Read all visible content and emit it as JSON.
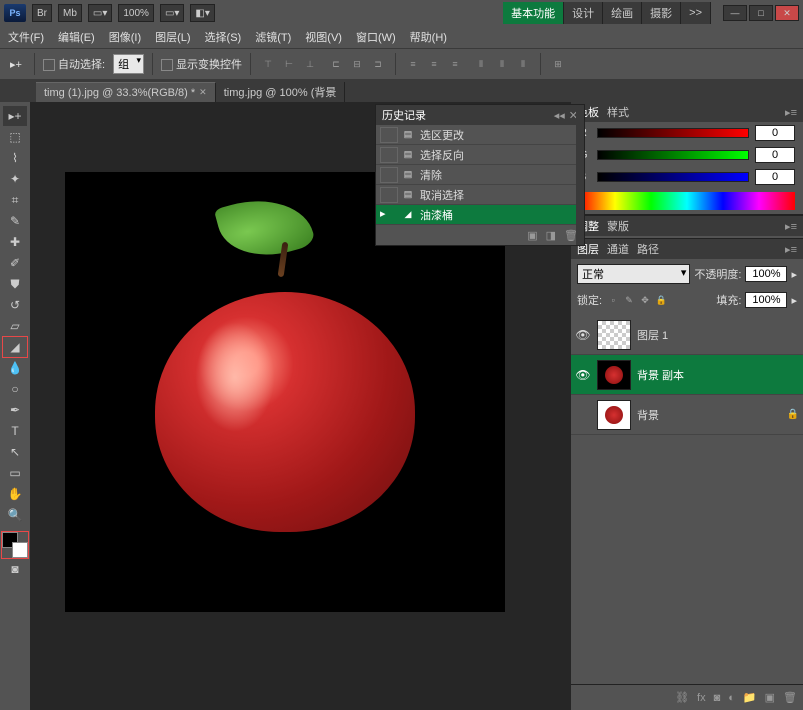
{
  "top": {
    "zoom": "100%",
    "workspaces": [
      "基本功能",
      "设计",
      "绘画",
      "摄影"
    ],
    "ws_more": ">>",
    "win": {
      "min": "—",
      "max": "□",
      "close": "✕"
    }
  },
  "menu": [
    "文件(F)",
    "编辑(E)",
    "图像(I)",
    "图层(L)",
    "选择(S)",
    "滤镜(T)",
    "视图(V)",
    "窗口(W)",
    "帮助(H)"
  ],
  "options": {
    "auto_select": "自动选择:",
    "group": "组",
    "show_transform": "显示变换控件"
  },
  "tabs": [
    {
      "label": "timg (1).jpg @ 33.3%(RGB/8) *",
      "active": true
    },
    {
      "label": "timg.jpg @ 100% (背景",
      "active": false
    }
  ],
  "history": {
    "title": "历史记录",
    "items": [
      "选区更改",
      "选择反向",
      "清除",
      "取消选择",
      "油漆桶"
    ]
  },
  "color_panel": {
    "tabs": [
      "色板",
      "样式"
    ],
    "r": "0",
    "g": "0",
    "b": "0",
    "r_label": "R",
    "g_label": "G",
    "b_label": "B"
  },
  "adjust": {
    "tabs": [
      "调整",
      "蒙版"
    ]
  },
  "layers": {
    "tabs": [
      "图层",
      "通道",
      "路径"
    ],
    "mode": "正常",
    "opacity_label": "不透明度:",
    "opacity": "100%",
    "lock_label": "锁定:",
    "fill_label": "填充:",
    "fill": "100%",
    "items": [
      {
        "name": "图层 1",
        "thumb": "checker",
        "visible": true,
        "locked": false
      },
      {
        "name": "背景 副本",
        "thumb": "apple",
        "visible": true,
        "locked": false,
        "active": true
      },
      {
        "name": "背景",
        "thumb": "apple-white",
        "visible": false,
        "locked": true
      }
    ]
  }
}
